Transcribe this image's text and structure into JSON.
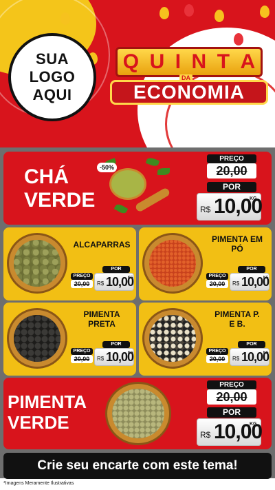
{
  "header": {
    "logo_line1": "SUA",
    "logo_line2": "LOGO",
    "logo_line3": "AQUI",
    "title_letters": [
      "Q",
      "U",
      "I",
      "N",
      "T",
      "A"
    ],
    "title_da": "DA",
    "title_economia": "ECONOMIA"
  },
  "common": {
    "preco_label": "PREÇO",
    "por_label": "POR",
    "currency": "R$",
    "unit": "KG"
  },
  "products": {
    "cha_verde": {
      "name_line1": "CHÁ",
      "name_line2": "VERDE",
      "discount": "-50%",
      "old_price": "20,00",
      "new_price": "10,00"
    },
    "alcaparras": {
      "name_line1": "ALCAPARRAS",
      "name_line2": "",
      "old_price": "20,00",
      "new_price": "10,00"
    },
    "pimenta_po": {
      "name_line1": "PIMENTA EM",
      "name_line2": "PÓ",
      "old_price": "20,00",
      "new_price": "10,00"
    },
    "pimenta_preta": {
      "name_line1": "PIMENTA",
      "name_line2": "PRETA",
      "old_price": "20,00",
      "new_price": "10,00"
    },
    "pimenta_pb": {
      "name_line1": "PIMENTA P.",
      "name_line2": "E B.",
      "old_price": "20,00",
      "new_price": "10,00"
    },
    "pimenta_verde": {
      "name_line1": "PIMENTA",
      "name_line2": "VERDE",
      "old_price": "20,00",
      "new_price": "10,00"
    }
  },
  "footer": {
    "banner": "Crie seu encarte com este tema!",
    "disclaimer": "*Imagens Meramente Ilustrativas"
  },
  "colors": {
    "red": "#d8141c",
    "yellow": "#f2bf14",
    "black": "#111111"
  }
}
